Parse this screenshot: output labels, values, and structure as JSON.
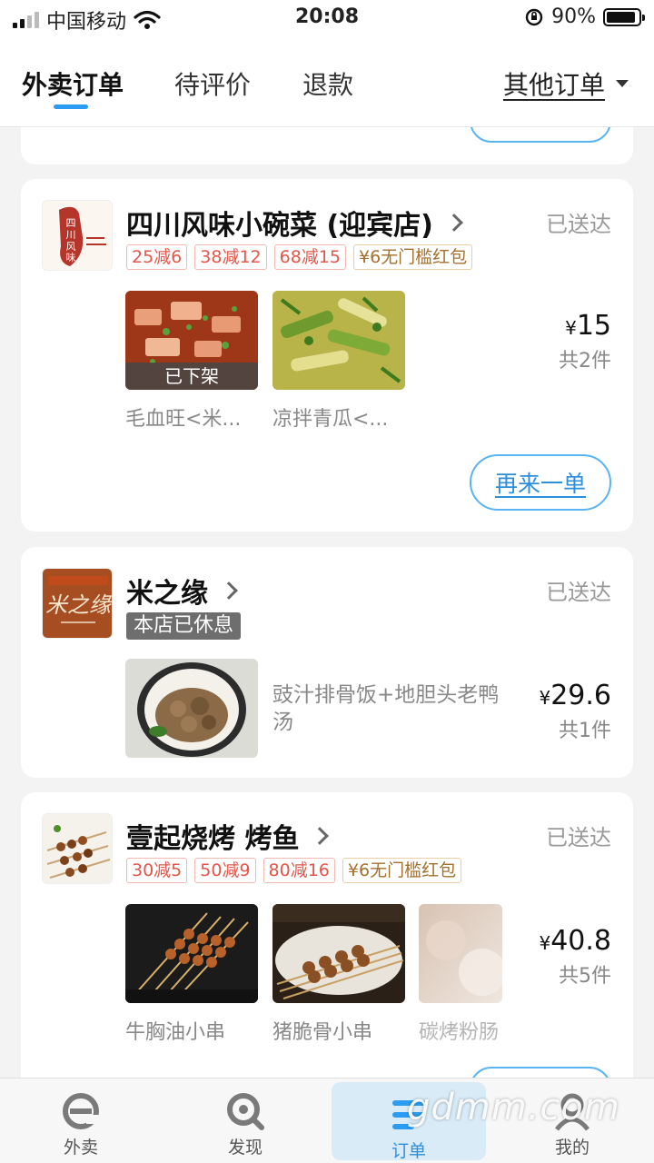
{
  "status_bar": {
    "carrier": "中国移动",
    "time": "20:08",
    "battery": "90%",
    "battery_level": 0.9
  },
  "tabs": {
    "items": [
      "外卖订单",
      "待评价",
      "退款"
    ],
    "other": "其他订单"
  },
  "orders": [
    {
      "shop": "四川风味小碗菜 (迎宾店)",
      "status": "已送达",
      "tags": [
        "25减6",
        "38减12",
        "68减15",
        "¥6无门槛红包"
      ],
      "dishes": [
        {
          "name": "毛血旺<米...",
          "badge": "已下架"
        },
        {
          "name": "凉拌青瓜<..."
        }
      ],
      "price_symbol": "¥",
      "price": "15",
      "count": "共2件",
      "action": "再来一单",
      "logo_text": "四川风味"
    },
    {
      "shop": "米之缘",
      "status": "已送达",
      "closed": "本店已休息",
      "dish_desc": "豉汁排骨饭+地胆头老鸭汤",
      "price_symbol": "¥",
      "price": "29.6",
      "count": "共1件",
      "logo_text": "米之缘"
    },
    {
      "shop": "壹起烧烤 烤鱼",
      "status": "已送达",
      "tags": [
        "30减5",
        "50减9",
        "80减16",
        "¥6无门槛红包"
      ],
      "dishes": [
        {
          "name": "牛胸油小串"
        },
        {
          "name": "猪脆骨小串"
        },
        {
          "name": "碳烤粉肠"
        }
      ],
      "price_symbol": "¥",
      "price": "40.8",
      "count": "共5件"
    }
  ],
  "bottom_nav": [
    "外卖",
    "发现",
    "订单",
    "我的"
  ],
  "watermark": "gdmm.com",
  "colors": {
    "accent": "#2b9cf0",
    "tag_red": "#e4554a",
    "tag_gold": "#a5702c"
  }
}
